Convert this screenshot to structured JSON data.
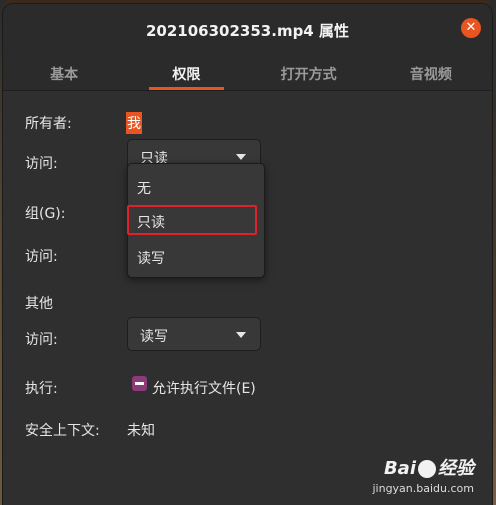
{
  "window": {
    "title": "202106302353.mp4 属性",
    "close_glyph": "✕"
  },
  "tabs": [
    {
      "label": "基本",
      "active": false
    },
    {
      "label": "权限",
      "active": true
    },
    {
      "label": "打开方式",
      "active": false
    },
    {
      "label": "音视频",
      "active": false
    }
  ],
  "owner": {
    "label": "所有者:",
    "value": "我",
    "access_label": "访问:",
    "access_value": "只读"
  },
  "group": {
    "label": "组(G):",
    "access_label": "访问:"
  },
  "dropdown": {
    "options": [
      "无",
      "只读",
      "读写"
    ],
    "highlighted": "只读"
  },
  "other": {
    "heading": "其他",
    "access_label": "访问:",
    "access_value": "读写"
  },
  "execute": {
    "label": "执行:",
    "checkbox_label": "允许执行文件(E)"
  },
  "security": {
    "label": "安全上下文:",
    "value": "未知"
  },
  "watermark": {
    "brand_left": "Bai",
    "brand_right": "经验",
    "url": "jingyan.baidu.com"
  },
  "colors": {
    "accent": "#e95420",
    "highlight_box": "#e0202a",
    "checkbox": "#8b3a7a"
  }
}
